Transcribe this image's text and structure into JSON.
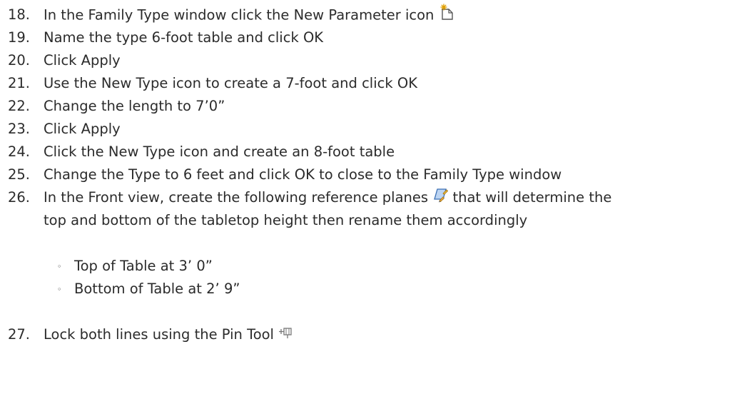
{
  "steps": [
    {
      "num": "18.",
      "text": "In the Family Type window click the New Parameter icon"
    },
    {
      "num": "19.",
      "text": "Name the type 6-foot table and click OK"
    },
    {
      "num": "20.",
      "text": "Click Apply"
    },
    {
      "num": "21.",
      "text": "Use the New Type icon to create a 7-foot and click OK"
    },
    {
      "num": "22.",
      "text": "Change the length to 7’0”"
    },
    {
      "num": "23.",
      "text": "Click Apply"
    },
    {
      "num": "24.",
      "text": "Click the New Type icon and create an 8-foot table"
    },
    {
      "num": "25.",
      "text": "Change the Type to 6 feet and click OK to close to the Family Type window"
    },
    {
      "num": "26.",
      "text_before": "In the Front view, create the following reference planes",
      "text_after": "that will determine the",
      "text_cont": "top and bottom of the tabletop height then rename them accordingly"
    },
    {
      "num": "27.",
      "text": "Lock both lines using the Pin Tool"
    }
  ],
  "subitems": [
    {
      "bullet": "◦",
      "text": "Top of Table at 3’ 0”"
    },
    {
      "bullet": "◦",
      "text": "Bottom of Table at 2’ 9”"
    }
  ],
  "icons": {
    "step18": "new-parameter-icon",
    "step26": "reference-plane-icon",
    "step27": "pin-tool-icon"
  }
}
